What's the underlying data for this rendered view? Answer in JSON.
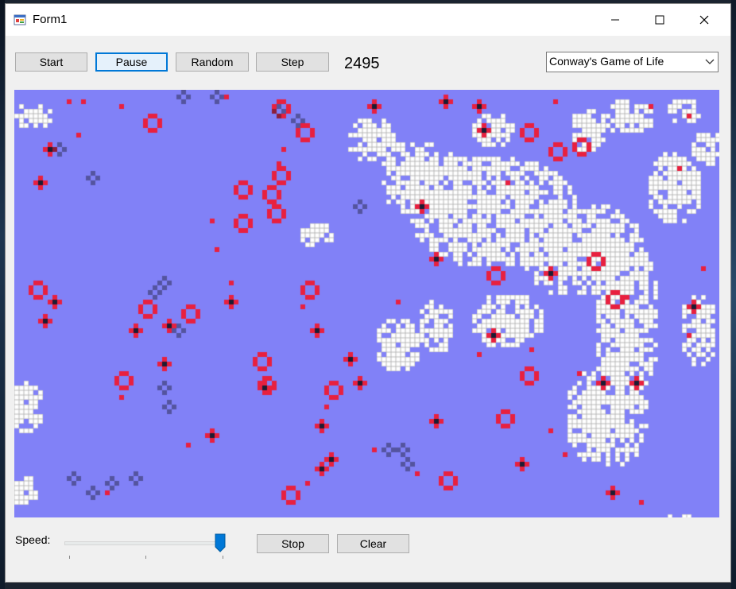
{
  "window": {
    "title": "Form1"
  },
  "titlebar": {
    "minimize_icon": "minimize-icon",
    "maximize_icon": "maximize-icon",
    "close_icon": "close-icon"
  },
  "toolbar": {
    "start_label": "Start",
    "pause_label": "Pause",
    "random_label": "Random",
    "step_label": "Step",
    "generation": "2495",
    "pattern_select": {
      "selected": "Conway's Game of Life"
    }
  },
  "board": {
    "background_color": "#8181f7",
    "live_color": "#ffffff",
    "gridline_color": "#b9b9b9",
    "accent_red": "#e8203f",
    "accent_dark": "#1c1c34"
  },
  "bottom": {
    "speed_label": "Speed:",
    "speed_level": 1.0,
    "stop_label": "Stop",
    "clear_label": "Clear"
  }
}
